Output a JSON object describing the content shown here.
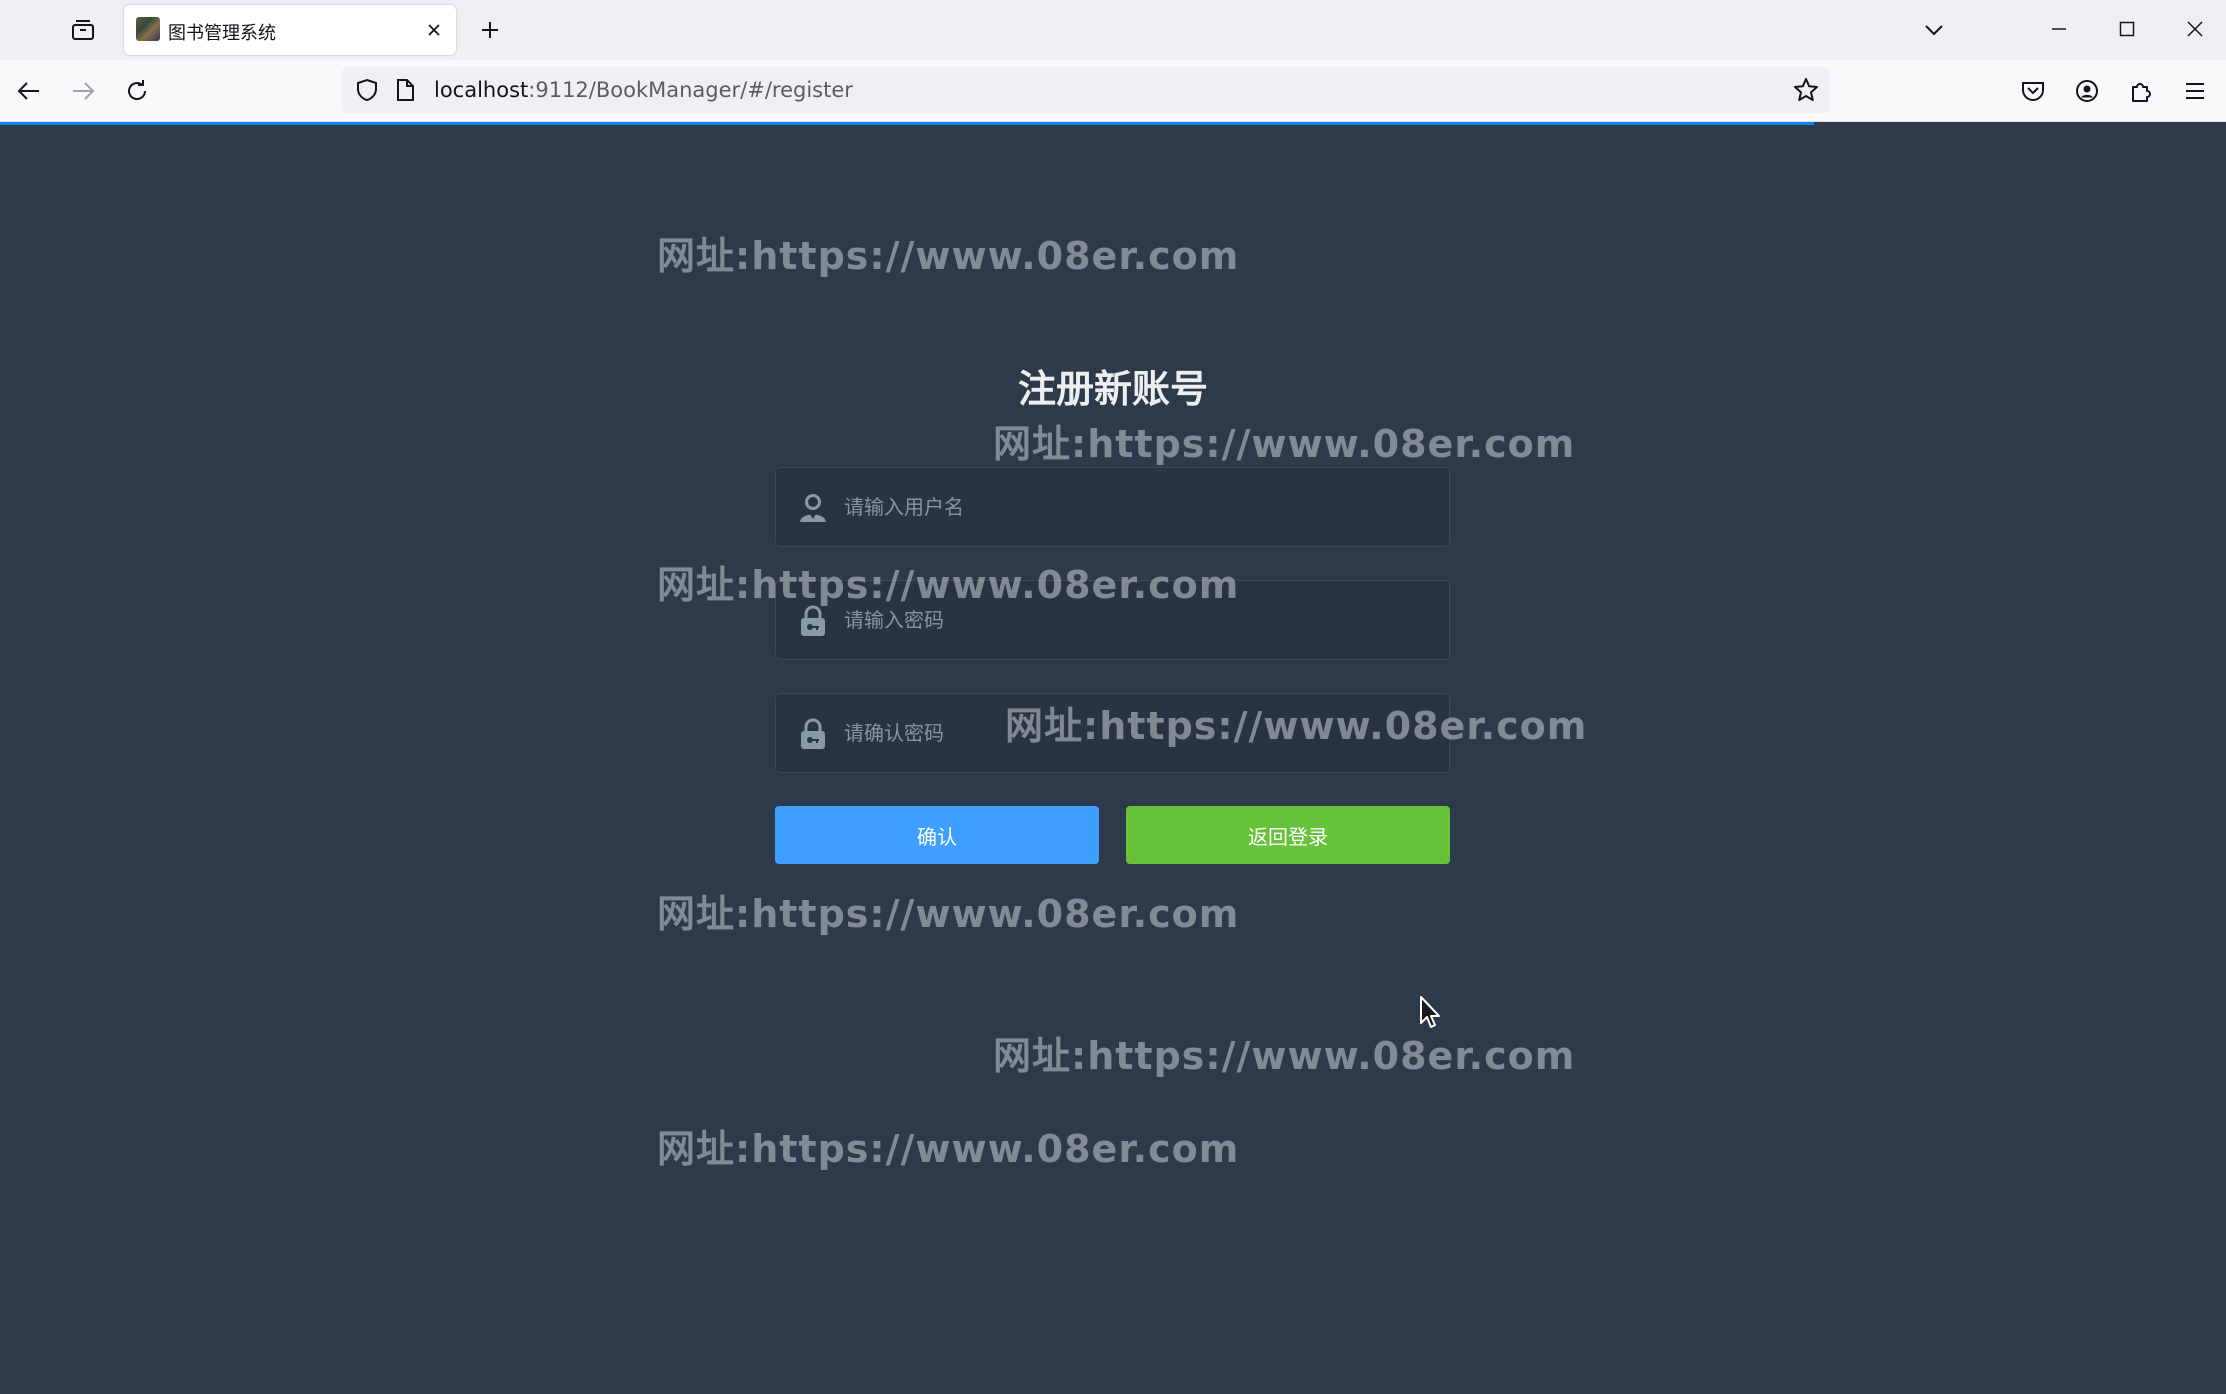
{
  "browser": {
    "tab_title": "图书管理系统",
    "url_host": "localhost",
    "url_path": ":9112/BookManager/#/register"
  },
  "page": {
    "title": "注册新账号",
    "username_placeholder": "请输入用户名",
    "password_placeholder": "请输入密码",
    "confirm_password_placeholder": "请确认密码",
    "confirm_button": "确认",
    "back_to_login_button": "返回登录",
    "watermark_text": "网址:https://www.08er.com"
  },
  "colors": {
    "background": "#2d3a4b",
    "confirm_button": "#409eff",
    "back_button": "#67c23a",
    "progress": "#0a84ff"
  }
}
